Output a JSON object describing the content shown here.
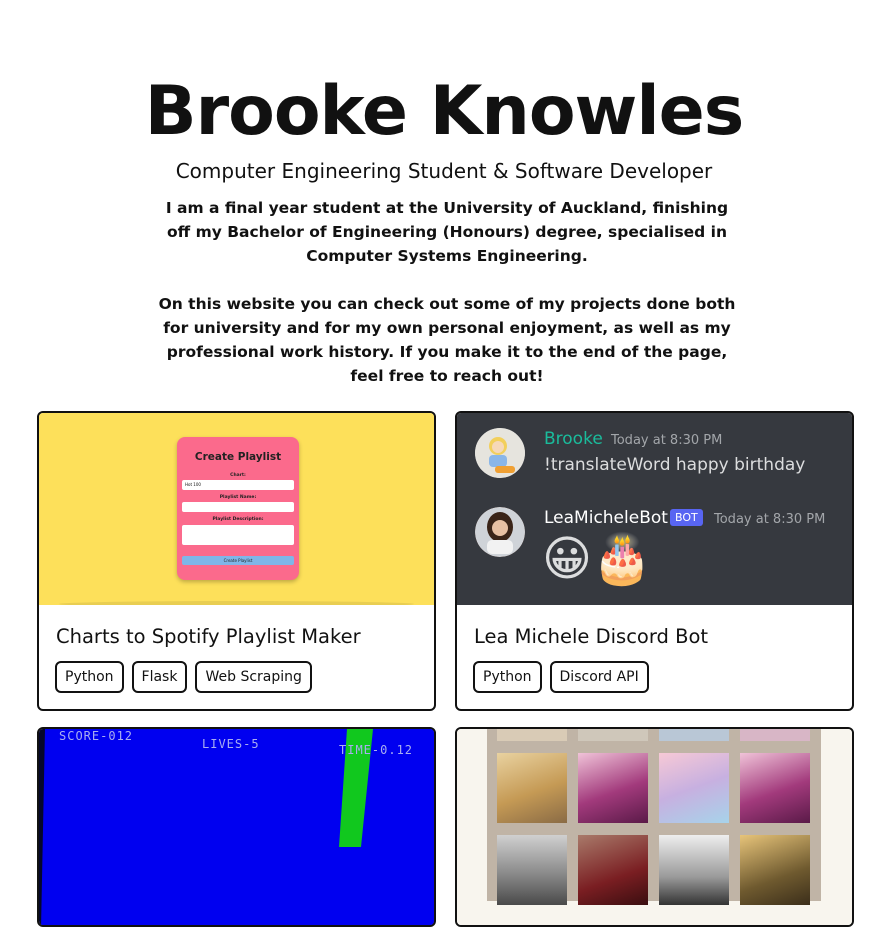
{
  "hero": {
    "name": "Brooke Knowles",
    "subtitle": "Computer Engineering Student & Software Developer",
    "intro_1": "I am a final year student at the University of Auckland, finishing off my Bachelor of Engineering (Honours) degree, specialised in Computer Systems Engineering.",
    "intro_2": "On this website you can check out some of my projects done both for university and for my own personal enjoyment, as well as my professional work history. If you make it to the end of the page, feel free to reach out!"
  },
  "projects": [
    {
      "title": "Charts to Spotify Playlist Maker",
      "tags": [
        "Python",
        "Flask",
        "Web Scraping"
      ],
      "thumbnail": {
        "form_title": "Create Playlist",
        "chart_label": "Chart:",
        "chart_value": "Hot 100",
        "name_label": "Playlist Name:",
        "desc_label": "Playlist Description:",
        "button_label": "Create Playlist"
      }
    },
    {
      "title": "Lea Michele Discord Bot",
      "tags": [
        "Python",
        "Discord API"
      ],
      "thumbnail": {
        "user1": "Brooke",
        "time1": "Today at 8:30 PM",
        "message1": "!translateWord happy birthday",
        "user2": "LeaMicheleBot",
        "bot_badge": "BOT",
        "time2": "Today at 8:30 PM",
        "emoji": "😀🎂"
      }
    },
    {
      "title": "",
      "tags": [],
      "thumbnail": {
        "score": "SCORE-012",
        "lives": "LIVES-5",
        "time": "TIME-0.12"
      }
    },
    {
      "title": "",
      "tags": [],
      "thumbnail": {}
    }
  ],
  "colors": {
    "spotify_bg": "#fde05a",
    "form_pink": "#fb6a8c",
    "discord_bg": "#36393f",
    "brooke_green": "#1abc9c",
    "bot_blurple": "#5865f2",
    "game_blue": "#0000f0",
    "paddle_green": "#11c81e"
  }
}
